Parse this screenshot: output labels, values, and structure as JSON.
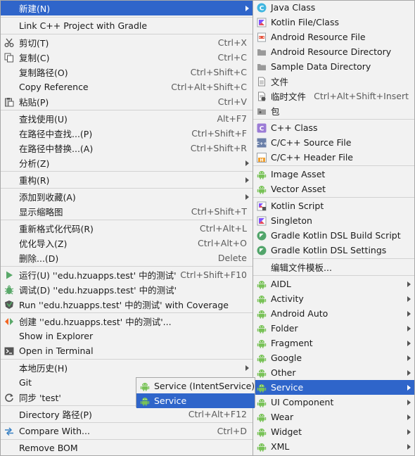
{
  "main_menu": [
    {
      "label": "新建(N)",
      "has_submenu": true,
      "selected": true,
      "icon": ""
    },
    {
      "label": "Link C++ Project with Gradle",
      "icon": ""
    },
    {
      "label": "剪切(T)",
      "shortcut": "Ctrl+X",
      "icon": "scissors-icon"
    },
    {
      "label": "复制(C)",
      "shortcut": "Ctrl+C",
      "icon": "copy-icon"
    },
    {
      "label": "复制路径(O)",
      "shortcut": "Ctrl+Shift+C",
      "icon": ""
    },
    {
      "label": "Copy Reference",
      "shortcut": "Ctrl+Alt+Shift+C",
      "icon": ""
    },
    {
      "label": "粘贴(P)",
      "shortcut": "Ctrl+V",
      "icon": "paste-icon"
    },
    {
      "label": "查找使用(U)",
      "shortcut": "Alt+F7",
      "icon": ""
    },
    {
      "label": "在路径中查找...(P)",
      "shortcut": "Ctrl+Shift+F",
      "icon": ""
    },
    {
      "label": "在路径中替换...(A)",
      "shortcut": "Ctrl+Shift+R",
      "icon": ""
    },
    {
      "label": "分析(Z)",
      "has_submenu": true,
      "icon": ""
    },
    {
      "label": "重构(R)",
      "has_submenu": true,
      "icon": ""
    },
    {
      "label": "添加到收藏(A)",
      "has_submenu": true,
      "icon": ""
    },
    {
      "label": "显示缩略图",
      "shortcut": "Ctrl+Shift+T",
      "icon": ""
    },
    {
      "label": "重新格式化代码(R)",
      "shortcut": "Ctrl+Alt+L",
      "icon": ""
    },
    {
      "label": "优化导入(Z)",
      "shortcut": "Ctrl+Alt+O",
      "icon": ""
    },
    {
      "label": "删除...(D)",
      "shortcut": "Delete",
      "icon": ""
    },
    {
      "label": "运行(U) ''edu.hzuapps.test' 中的测试'",
      "shortcut": "Ctrl+Shift+F10",
      "icon": "run-icon"
    },
    {
      "label": "调试(D) ''edu.hzuapps.test' 中的测试'",
      "icon": "debug-icon"
    },
    {
      "label": "Run ''edu.hzuapps.test' 中的测试' with Coverage",
      "icon": "coverage-icon"
    },
    {
      "label": "创建 ''edu.hzuapps.test' 中的测试'...",
      "icon": "create-test-icon"
    },
    {
      "label": "Show in Explorer",
      "icon": ""
    },
    {
      "label": "Open in Terminal",
      "icon": "terminal-icon"
    },
    {
      "label": "本地历史(H)",
      "has_submenu": true,
      "icon": ""
    },
    {
      "label": "Git",
      "has_submenu": true,
      "icon": ""
    },
    {
      "label": "同步 'test'",
      "icon": "sync-icon"
    },
    {
      "label": "Directory 路径(P)",
      "shortcut": "Ctrl+Alt+F12",
      "icon": ""
    },
    {
      "label": "Compare With...",
      "shortcut": "Ctrl+D",
      "icon": "compare-icon"
    },
    {
      "label": "Remove BOM",
      "icon": ""
    }
  ],
  "new_submenu": [
    {
      "label": "Java Class",
      "icon": "java-class-icon"
    },
    {
      "label": "Kotlin File/Class",
      "icon": "kotlin-file-icon"
    },
    {
      "label": "Android Resource File",
      "icon": "android-resource-file-icon"
    },
    {
      "label": "Android Resource Directory",
      "icon": "folder-icon"
    },
    {
      "label": "Sample Data Directory",
      "icon": "folder-icon"
    },
    {
      "label": "文件",
      "icon": "file-icon"
    },
    {
      "label": "临时文件",
      "shortcut": "Ctrl+Alt+Shift+Insert",
      "icon": "scratch-file-icon"
    },
    {
      "label": "包",
      "icon": "package-icon"
    },
    {
      "label": "C++ Class",
      "icon": "cpp-class-icon"
    },
    {
      "label": "C/C++ Source File",
      "icon": "cpp-source-icon"
    },
    {
      "label": "C/C++ Header File",
      "icon": "cpp-header-icon"
    },
    {
      "label": "Image Asset",
      "icon": "android-icon"
    },
    {
      "label": "Vector Asset",
      "icon": "android-icon"
    },
    {
      "label": "Kotlin Script",
      "icon": "kotlin-script-icon"
    },
    {
      "label": "Singleton",
      "icon": "singleton-icon"
    },
    {
      "label": "Gradle Kotlin DSL Build Script",
      "icon": "gradle-kotlin-icon"
    },
    {
      "label": "Gradle Kotlin DSL Settings",
      "icon": "gradle-kotlin-icon"
    },
    {
      "label": "编辑文件模板...",
      "icon": ""
    },
    {
      "label": "AIDL",
      "has_submenu": true,
      "icon": "android-icon"
    },
    {
      "label": "Activity",
      "has_submenu": true,
      "icon": "android-icon"
    },
    {
      "label": "Android Auto",
      "has_submenu": true,
      "icon": "android-icon"
    },
    {
      "label": "Folder",
      "has_submenu": true,
      "icon": "android-icon"
    },
    {
      "label": "Fragment",
      "has_submenu": true,
      "icon": "android-icon"
    },
    {
      "label": "Google",
      "has_submenu": true,
      "icon": "android-icon"
    },
    {
      "label": "Other",
      "has_submenu": true,
      "icon": "android-icon"
    },
    {
      "label": "Service",
      "has_submenu": true,
      "selected": true,
      "icon": "android-icon"
    },
    {
      "label": "UI Component",
      "has_submenu": true,
      "icon": "android-icon"
    },
    {
      "label": "Wear",
      "has_submenu": true,
      "icon": "android-icon"
    },
    {
      "label": "Widget",
      "has_submenu": true,
      "icon": "android-icon"
    },
    {
      "label": "XML",
      "has_submenu": true,
      "icon": "android-icon"
    }
  ],
  "service_submenu": [
    {
      "label": "Service (IntentService)",
      "icon": "android-icon"
    },
    {
      "label": "Service",
      "selected": true,
      "icon": "android-icon"
    }
  ],
  "colors": {
    "selection": "#2f65ca",
    "menu_bg": "#f2f2f2",
    "android": "#78c257"
  }
}
